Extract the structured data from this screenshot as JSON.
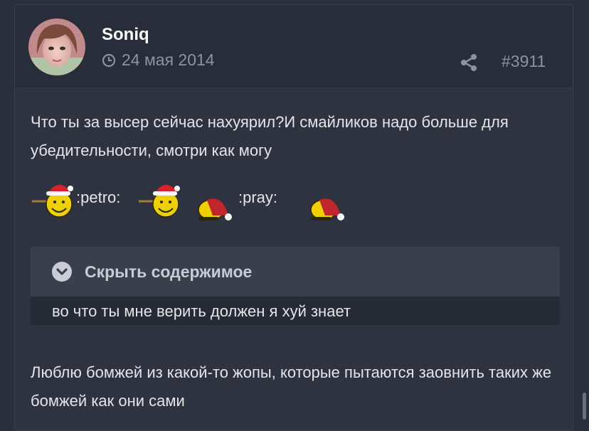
{
  "post": {
    "author": "Soniq",
    "date": "24 мая 2014",
    "number": "#3911",
    "paragraph1": "Что ты за высер сейчас нахуярил?И смайликов надо больше для убедительности, смотри как могу",
    "smiley_codes": [
      ":petro:",
      ":pray:"
    ],
    "spoiler": {
      "label": "Скрыть содержимое",
      "content": "во что ты мне верить должен я хуй знает"
    },
    "paragraph2": "Люблю бомжей из какой-то жопы, которые пытаются заовнить таких же бомжей как они сами"
  },
  "icons": {
    "clock": "clock-icon",
    "share": "share-icon",
    "spoiler_toggle": "chevron-down-icon"
  },
  "colors": {
    "background": "#2b2f3c",
    "header": "#292d39",
    "text": "#e3e5ea",
    "muted": "#8c92a3",
    "spoiler_header": "#3a3f4c"
  }
}
